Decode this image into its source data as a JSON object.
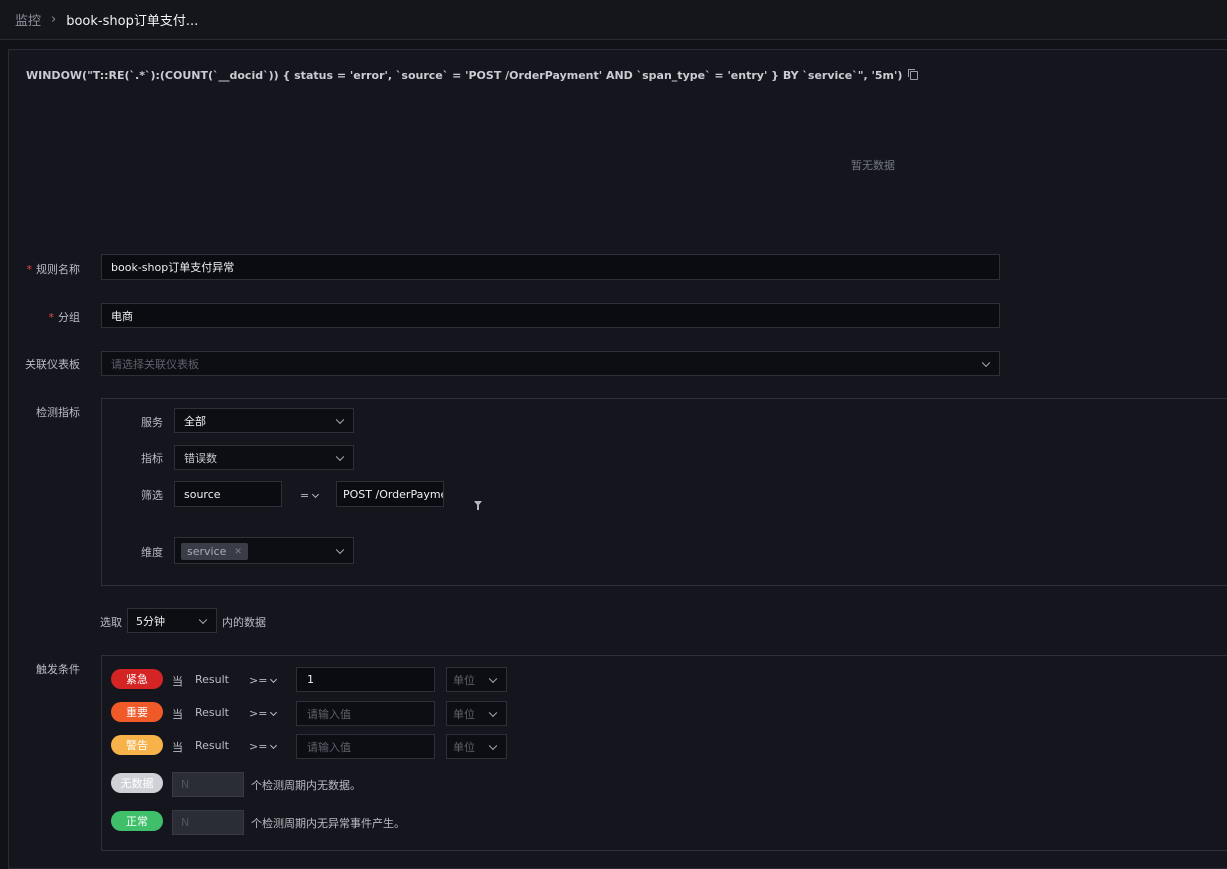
{
  "breadcrumb": {
    "root": "监控",
    "current": "book-shop订单支付..."
  },
  "query": "WINDOW(\"T::RE(`.*`):(COUNT(`__docid`)) { status = 'error', `source` = 'POST /OrderPayment' AND `span_type` = 'entry' } BY `service`\", '5m')",
  "chart": {
    "empty_text": "暂无数据"
  },
  "form": {
    "rule_name": {
      "label": "规则名称",
      "value": "book-shop订单支付异常"
    },
    "group": {
      "label": "分组",
      "value": "电商"
    },
    "dashboard": {
      "label": "关联仪表板",
      "placeholder": "请选择关联仪表板"
    },
    "metric": {
      "label": "检测指标",
      "service_label": "服务",
      "service_value": "全部",
      "indicator_label": "指标",
      "indicator_value": "错误数",
      "filter_label": "筛选",
      "filter_field": "source",
      "filter_op": "=",
      "filter_value": "POST /OrderPayme",
      "dimension_label": "维度",
      "dimension_tag": "service"
    },
    "window": {
      "prefix": "选取",
      "value": "5分钟",
      "suffix": "内的数据"
    },
    "trigger": {
      "label": "触发条件",
      "rows": [
        {
          "level": "紧急",
          "color": "#d42424",
          "when": "当",
          "field": "Result",
          "op": ">=",
          "value": "1",
          "placeholder": "",
          "unit": "单位"
        },
        {
          "level": "重要",
          "color": "#f05a28",
          "when": "当",
          "field": "Result",
          "op": ">=",
          "value": "",
          "placeholder": "请输入值",
          "unit": "单位"
        },
        {
          "level": "警告",
          "color": "#f7b24a",
          "when": "当",
          "field": "Result",
          "op": ">=",
          "value": "",
          "placeholder": "请输入值",
          "unit": "单位"
        }
      ],
      "nodata": {
        "level": "无数据",
        "color": "#cfd1d6",
        "placeholder": "N",
        "text": "个检测周期内无数据。"
      },
      "normal": {
        "level": "正常",
        "color": "#3fbf6a",
        "placeholder": "N",
        "text": "个检测周期内无异常事件产生。"
      }
    }
  }
}
